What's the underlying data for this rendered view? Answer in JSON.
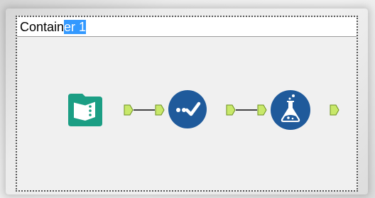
{
  "container": {
    "title_before_selection": "Contain",
    "title_selected": "er 1"
  },
  "tools": [
    {
      "name": "input-data-tool",
      "icon": "book-icon",
      "color": "#1b9e84"
    },
    {
      "name": "select-tool",
      "icon": "checkmark-icon",
      "color": "#1f5a9b"
    },
    {
      "name": "formula-tool",
      "icon": "flask-icon",
      "color": "#1f5a9b"
    }
  ],
  "colors": {
    "anchor_fill": "#c8e86a",
    "anchor_stroke": "#6b8f1f",
    "selection": "#3399ff"
  }
}
